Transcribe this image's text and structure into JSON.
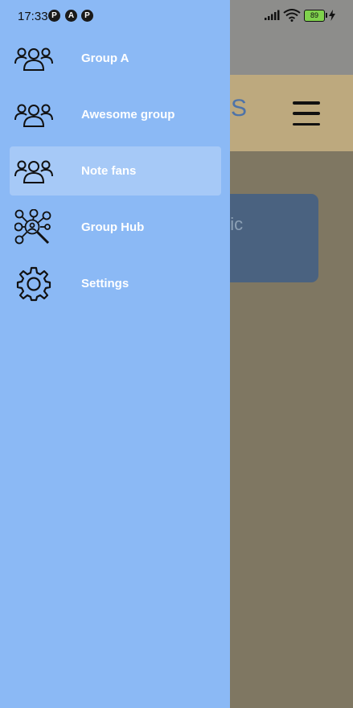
{
  "status_bar": {
    "time": "17:33",
    "notification_icons": [
      "P",
      "A",
      "P"
    ],
    "battery_level": "89"
  },
  "background_app": {
    "title_fragment": "S",
    "card_text_fragment": "pic"
  },
  "drawer": {
    "items": [
      {
        "label": "Group A",
        "icon": "group-icon",
        "selected": false
      },
      {
        "label": "Awesome group",
        "icon": "group-icon",
        "selected": false
      },
      {
        "label": "Note fans",
        "icon": "group-icon",
        "selected": true
      },
      {
        "label": "Group Hub",
        "icon": "network-search-icon",
        "selected": false
      },
      {
        "label": "Settings",
        "icon": "gear-icon",
        "selected": false
      }
    ]
  },
  "colors": {
    "drawer_bg": "#8bb9f5",
    "selected_item_bg": "#a6c9f7",
    "label_text": "#ffffff",
    "scrim_bg": "#7f7762"
  }
}
